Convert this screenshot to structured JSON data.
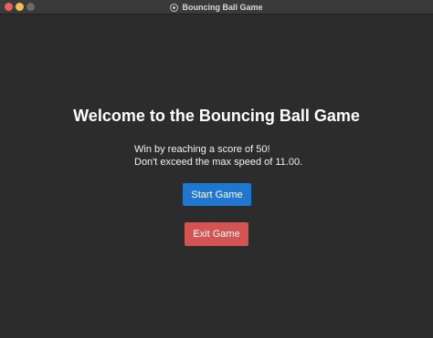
{
  "window": {
    "title": "Bouncing Ball Game",
    "app_icon": "ball-icon"
  },
  "main": {
    "heading": "Welcome to the Bouncing Ball Game",
    "info_lines": [
      "Win by reaching a score of 50!",
      "Don't exceed the max speed of 11.00."
    ],
    "start_label": "Start Game",
    "exit_label": "Exit Game"
  },
  "colors": {
    "background": "#2c2c2c",
    "start_button": "#1f77d0",
    "exit_button": "#d45453",
    "close_light": "#ee5f57",
    "minimize_light": "#f4bd4f"
  }
}
